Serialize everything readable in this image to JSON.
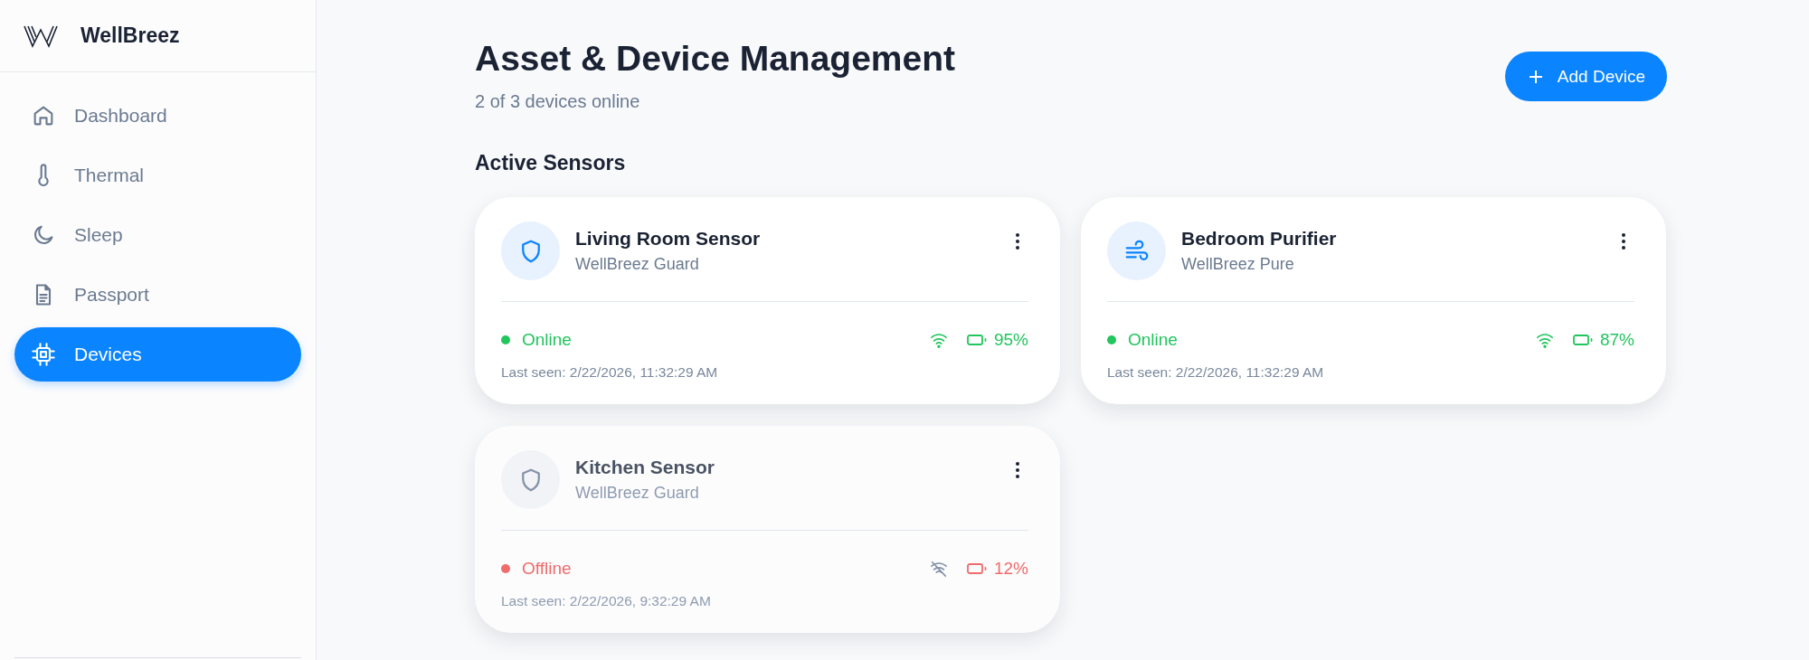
{
  "brand": {
    "name": "WellBreez"
  },
  "nav": [
    {
      "label": "Dashboard",
      "kind": "home",
      "selected": false
    },
    {
      "label": "Thermal",
      "kind": "thermometer",
      "selected": false
    },
    {
      "label": "Sleep",
      "kind": "moon",
      "selected": false
    },
    {
      "label": "Passport",
      "kind": "document",
      "selected": false
    },
    {
      "label": "Devices",
      "kind": "chip",
      "selected": true
    }
  ],
  "header": {
    "title": "Asset & Device Management",
    "subtitle": "2 of 3 devices online",
    "add_button": "Add Device"
  },
  "section_title": "Active Sensors",
  "devices": [
    {
      "name": "Living Room Sensor",
      "model": "WellBreez Guard",
      "kind": "shield",
      "online": true,
      "status": "Online",
      "battery": "95%",
      "last_seen": "Last seen: 2/22/2026, 11:32:29 AM"
    },
    {
      "name": "Bedroom Purifier",
      "model": "WellBreez Pure",
      "kind": "wind",
      "online": true,
      "status": "Online",
      "battery": "87%",
      "last_seen": "Last seen: 2/22/2026, 11:32:29 AM"
    },
    {
      "name": "Kitchen Sensor",
      "model": "WellBreez Guard",
      "kind": "shield",
      "online": false,
      "status": "Offline",
      "battery": "12%",
      "last_seen": "Last seen: 2/22/2026, 9:32:29 AM"
    }
  ]
}
